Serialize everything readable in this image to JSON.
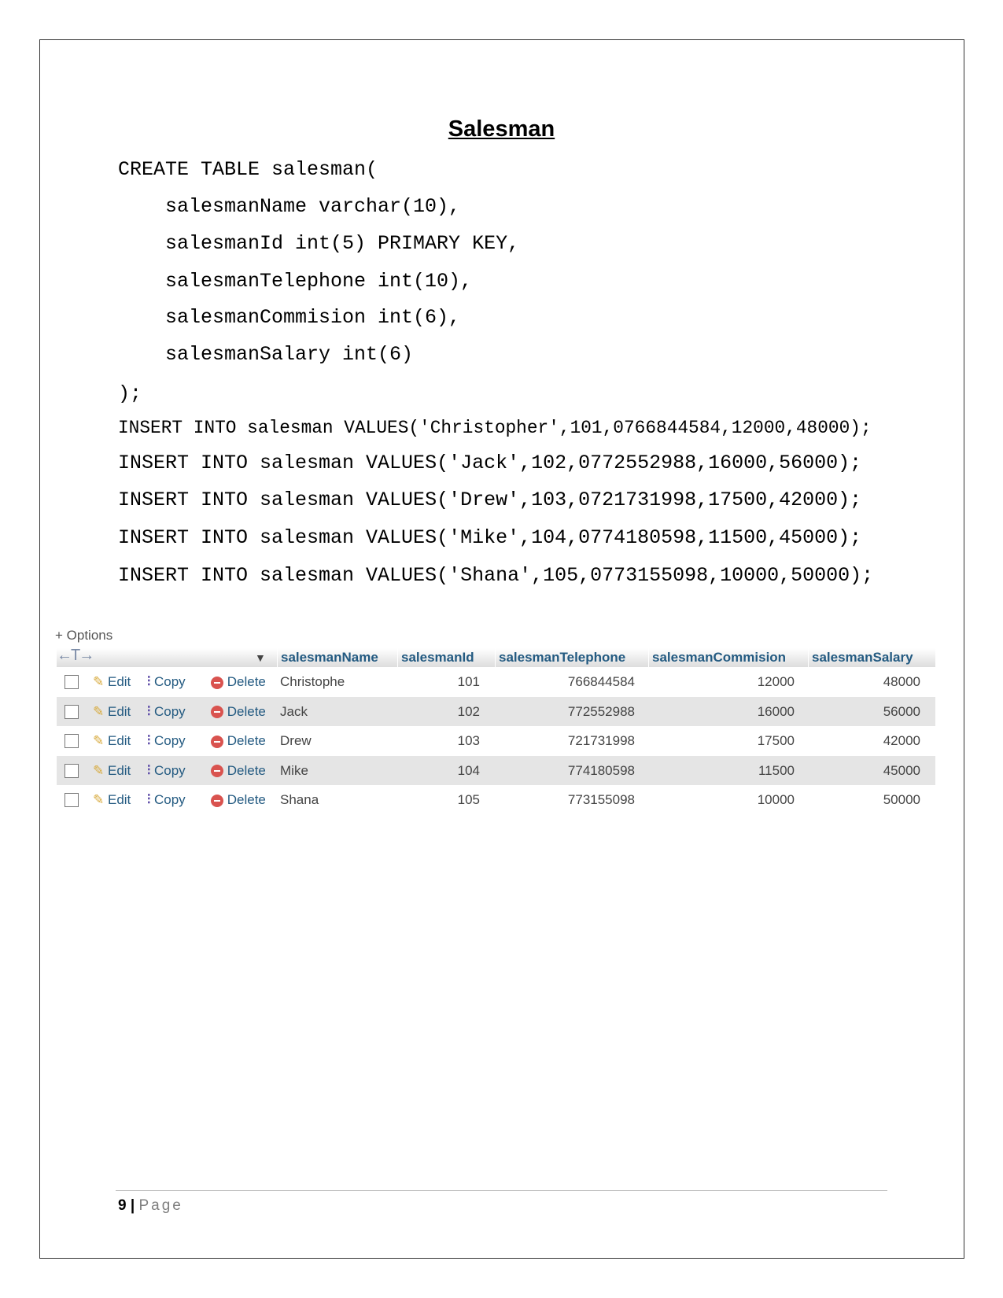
{
  "title": "Salesman",
  "code": {
    "create": "CREATE TABLE salesman(",
    "cols": [
      "salesmanName varchar(10),",
      "salesmanId int(5) PRIMARY KEY,",
      "salesmanTelephone int(10),",
      "salesmanCommision int(6),",
      "salesmanSalary int(6)"
    ],
    "close": ");",
    "inserts": [
      "INSERT INTO salesman VALUES('Christopher',101,0766844584,12000,48000);",
      "INSERT INTO salesman VALUES('Jack',102,0772552988,16000,56000);",
      "INSERT INTO salesman VALUES('Drew',103,0721731998,17500,42000);",
      "INSERT INTO salesman VALUES('Mike',104,0774180598,11500,45000);",
      "INSERT INTO salesman VALUES('Shana',105,0773155098,10000,50000);"
    ]
  },
  "table": {
    "options_label": "+ Options",
    "arrows": "←T→",
    "actions": {
      "edit": "Edit",
      "copy": "Copy",
      "delete": "Delete"
    },
    "headers": [
      "salesmanName",
      "salesmanId",
      "salesmanTelephone",
      "salesmanCommision",
      "salesmanSalary"
    ],
    "rows": [
      [
        "Christophe",
        "101",
        "766844584",
        "12000",
        "48000"
      ],
      [
        "Jack",
        "102",
        "772552988",
        "16000",
        "56000"
      ],
      [
        "Drew",
        "103",
        "721731998",
        "17500",
        "42000"
      ],
      [
        "Mike",
        "104",
        "774180598",
        "11500",
        "45000"
      ],
      [
        "Shana",
        "105",
        "773155098",
        "10000",
        "50000"
      ]
    ]
  },
  "footer": {
    "page_number": "9",
    "separator": "|",
    "page_label": "Page"
  }
}
